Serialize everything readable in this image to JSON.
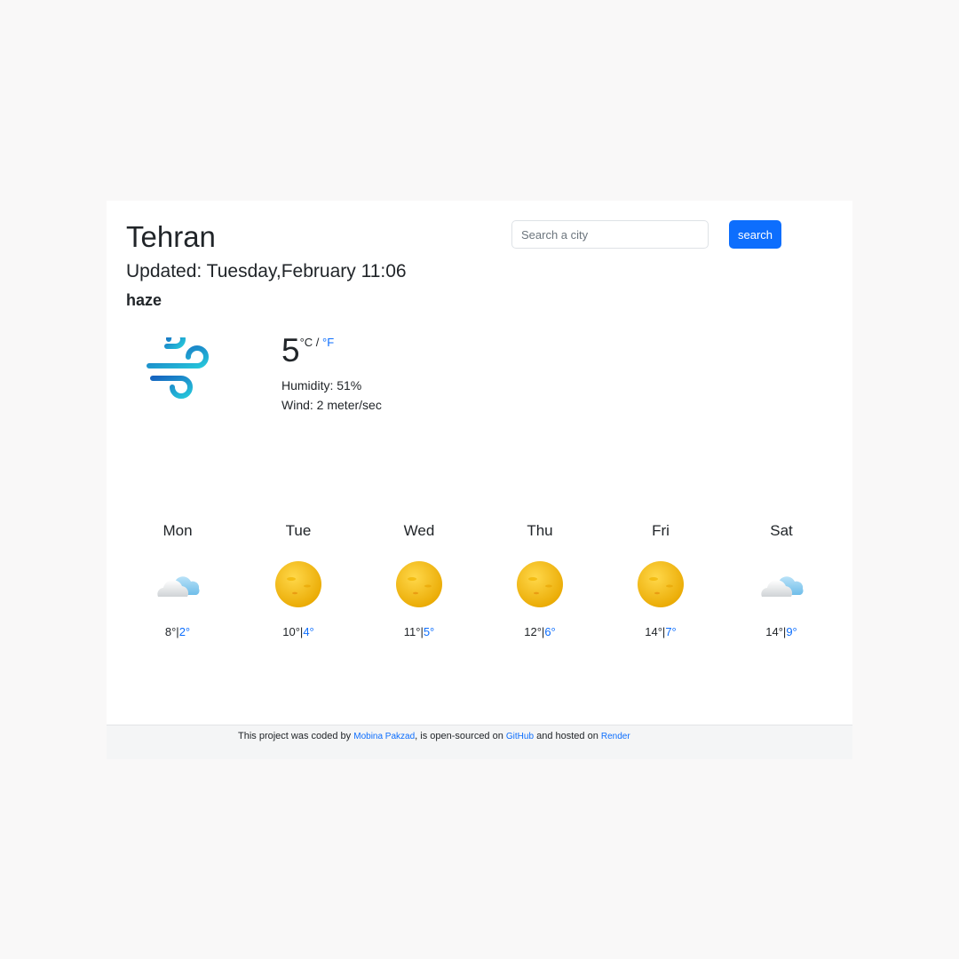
{
  "header": {
    "city": "Tehran",
    "updated": "Updated: Tuesday,February 11:06",
    "description": "haze"
  },
  "search": {
    "placeholder": "Search a city",
    "button_label": "search"
  },
  "current": {
    "icon": "wind-icon",
    "temperature": "5",
    "unit_c": "°C",
    "unit_sep": " / ",
    "unit_f": "°F",
    "humidity": "Humidity: 51%",
    "wind": "Wind: 2 meter/sec"
  },
  "forecast": [
    {
      "day": "Mon",
      "icon": "cloud-icon",
      "max": "8°",
      "sep": "|",
      "min": "2°"
    },
    {
      "day": "Tue",
      "icon": "sun-icon",
      "max": "10°",
      "sep": "|",
      "min": "4°"
    },
    {
      "day": "Wed",
      "icon": "sun-icon",
      "max": "11°",
      "sep": "|",
      "min": "5°"
    },
    {
      "day": "Thu",
      "icon": "sun-icon",
      "max": "12°",
      "sep": "|",
      "min": "6°"
    },
    {
      "day": "Fri",
      "icon": "sun-icon",
      "max": "14°",
      "sep": "|",
      "min": "7°"
    },
    {
      "day": "Sat",
      "icon": "cloud-icon",
      "max": "14°",
      "sep": "|",
      "min": "9°"
    }
  ],
  "footer": {
    "text1": "This project was coded by ",
    "author": "Mobina Pakzad",
    "text2": ", is open-sourced on ",
    "github": "GitHub",
    "text3": " and hosted on ",
    "render": "Render"
  },
  "colors": {
    "accent": "#0d6efd",
    "background": "#f9f8f8",
    "sun": "#f5b800",
    "cloud": "#9ed3f2"
  }
}
